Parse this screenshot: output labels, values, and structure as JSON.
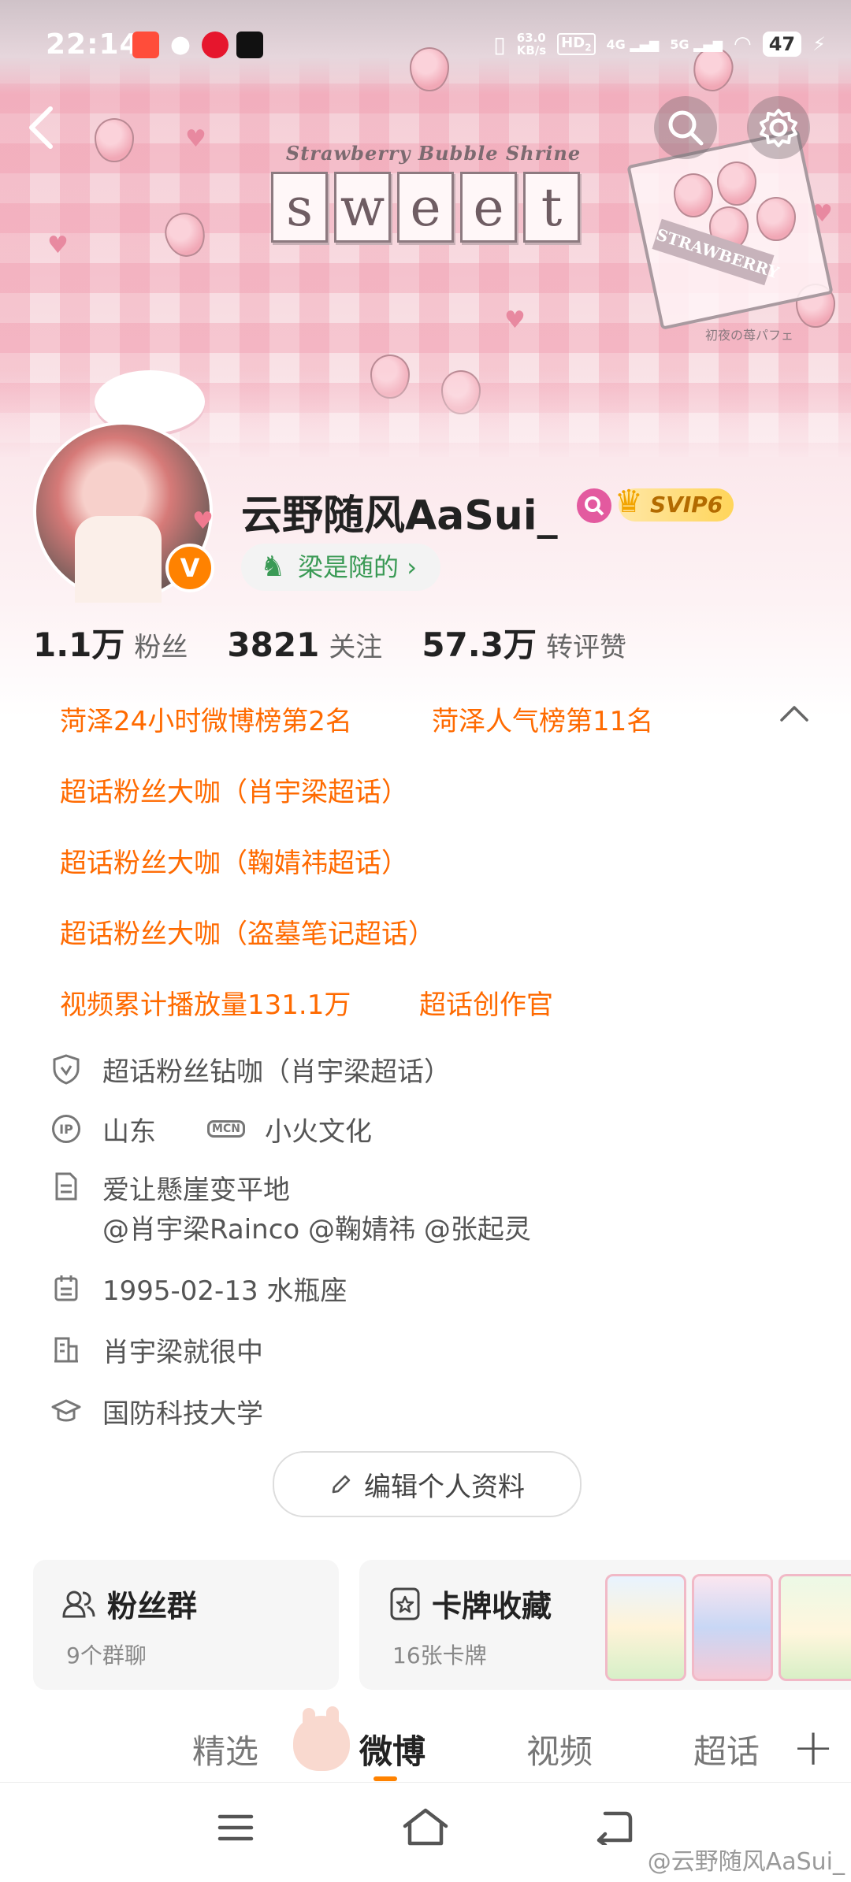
{
  "status_bar": {
    "time": "22:14",
    "net_speed_value": "63.0",
    "net_speed_unit": "KB/s",
    "hd": "HD",
    "hd_sub": "2",
    "net1": "4G",
    "net2": "5G",
    "battery": "47"
  },
  "banner": {
    "shrine_title": "Strawberry Bubble Shrine",
    "sweet_letters": [
      "s",
      "w",
      "e",
      "e",
      "t"
    ],
    "box_label": "STRAWBERRY",
    "small_caption": "初夜の苺パフェ"
  },
  "profile": {
    "username": "云野随风AaSui_",
    "svip_label": "SVIP6",
    "fan_tag": "梁是随的",
    "fan_tag_arrow": "›",
    "verified_mark": "V"
  },
  "stats": [
    {
      "value": "1.1万",
      "label": "粉丝"
    },
    {
      "value": "3821",
      "label": "关注"
    },
    {
      "value": "57.3万",
      "label": "转评赞"
    }
  ],
  "honors": {
    "row1a": "菏泽24小时微博榜第2名",
    "row1b": "菏泽人气榜第11名",
    "row2": "超话粉丝大咖（肖宇梁超话）",
    "row3": "超话粉丝大咖（鞠婧祎超话）",
    "row4": "超话粉丝大咖（盗墓笔记超话）",
    "row5a": "视频累计播放量131.1万",
    "row5b": "超话创作官"
  },
  "info": {
    "badge": "超话粉丝钻咖（肖宇梁超话）",
    "location": "山东",
    "mcn": "小火文化",
    "mcn_icon_text": "MCN",
    "ip_icon_text": "IP",
    "bio_line1": "爱让懸崖变平地",
    "bio_line2": "@肖宇梁Rainco @鞠婧祎 @张起灵",
    "birthday": "1995-02-13 水瓶座",
    "company": "肖宇梁就很中",
    "school": "国防科技大学"
  },
  "edit_button": "编辑个人资料",
  "cards": {
    "fans_group_title": "粉丝群",
    "fans_group_sub": "9个群聊",
    "cardpack_title": "卡牌收藏",
    "cardpack_sub": "16张卡牌"
  },
  "tabs": [
    "精选",
    "微博",
    "视频",
    "超话"
  ],
  "tab_plus": "+",
  "watermark": "@云野随风AaSui_",
  "colors": {
    "weibo_orange": "#ff6a00",
    "verified_orange": "#ff8200",
    "fan_green": "#3a9a55",
    "svip_gold": "#ffd55a",
    "banner_pink": "#f3c9d2"
  }
}
